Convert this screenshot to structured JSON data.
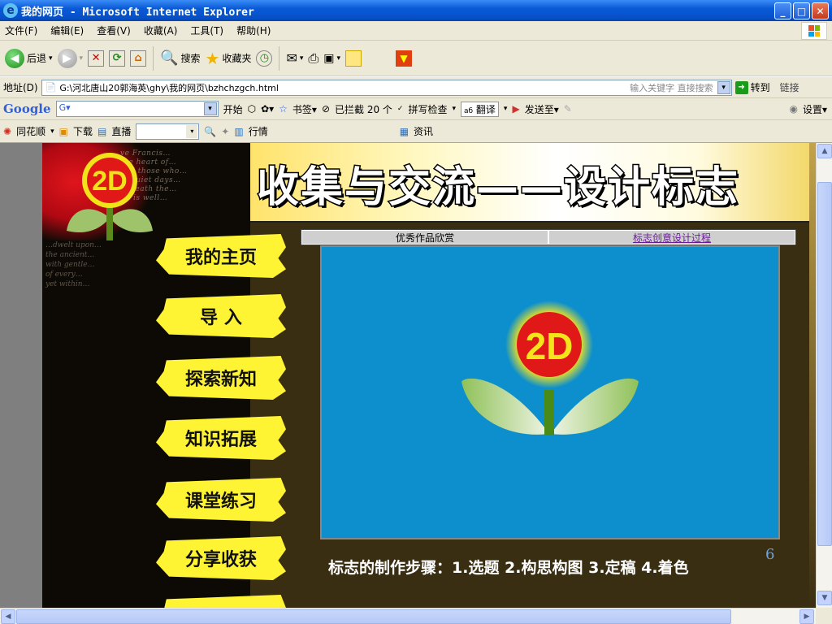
{
  "window": {
    "title": "我的网页 - Microsoft Internet Explorer",
    "controls": {
      "minimize": "_",
      "maximize": "□",
      "close": "✕"
    }
  },
  "menubar": {
    "items": [
      "文件(F)",
      "编辑(E)",
      "查看(V)",
      "收藏(A)",
      "工具(T)",
      "帮助(H)"
    ]
  },
  "toolbar": {
    "back_label": "后退",
    "search_label": "搜索",
    "favorites_label": "收藏夹"
  },
  "address": {
    "label": "地址(D)",
    "value": "G:\\河北唐山20郭海英\\ghy\\我的网页\\bzhchzgch.html",
    "hint": "输入关键字 直接搜索",
    "go_label": "转到",
    "links_label": "链接"
  },
  "google_toolbar": {
    "logo": "Google",
    "search_placeholder": "G▾",
    "start_label": "开始",
    "bookmarks_label": "书签▾",
    "blocked_label": "已拦截 20 个",
    "spellcheck_label": "拼写检查",
    "translate_label": "翻译",
    "sendto_label": "发送至▾",
    "settings_label": "设置▾"
  },
  "extra_toolbar": {
    "ths_label": "同花顺",
    "download_label": "下载",
    "live_label": "直播",
    "quotes_label": "行情",
    "news_label": "资讯"
  },
  "page": {
    "banner_title": "收集与交流——设计标志",
    "nav": [
      "我的主页",
      "导 入",
      "探索新知",
      "知识拓展",
      "课堂练习",
      "分享收获"
    ],
    "tabs": [
      {
        "label": "优秀作品欣赏",
        "is_link": false
      },
      {
        "label": "标志创意设计过程",
        "is_link": true
      }
    ],
    "caption": "标志的制作步骤：1.选题  2.构思构图 3.定稿 4.着色",
    "page_number": "6",
    "logo_text": "2D",
    "script_text_1": "ve Francis…\nthe heart of…\nand those who…\nin quiet days…\nbeneath the…\nall is well…",
    "script_text_2": "…dwelt upon…\nthe ancient…\nwith gentle…\nof every…\nyet within…"
  },
  "colors": {
    "title_blue": "#0a5ad6",
    "chrome": "#ece9d8",
    "nav_yellow": "#fff433",
    "frame_blue": "#0c8fcc",
    "logo_red": "#e01818"
  }
}
